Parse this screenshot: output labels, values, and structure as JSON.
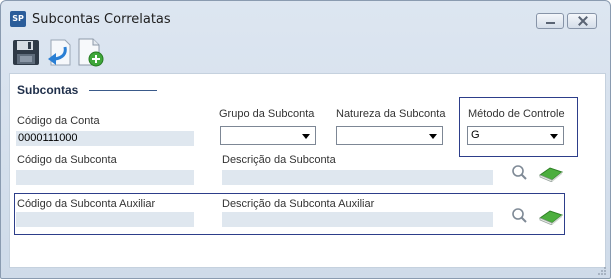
{
  "window": {
    "app_icon_text": "SP",
    "title": "Subcontas Correlatas"
  },
  "toolbar": {
    "buttons": [
      {
        "name": "save",
        "icon": "floppy-disk-icon"
      },
      {
        "name": "return",
        "icon": "return-arrow-icon"
      },
      {
        "name": "new",
        "icon": "new-document-icon"
      }
    ]
  },
  "section": {
    "title": "Subcontas"
  },
  "fields": {
    "codigo_conta": {
      "label": "Código da Conta",
      "value": "0000111000"
    },
    "grupo_subconta": {
      "label": "Grupo da Subconta",
      "value": ""
    },
    "natureza_subconta": {
      "label": "Natureza da Subconta",
      "value": ""
    },
    "metodo_controle": {
      "label": "Método de Controle",
      "value": "G"
    },
    "codigo_subconta": {
      "label": "Código da Subconta",
      "value": ""
    },
    "descricao_subconta": {
      "label": "Descrição da Subconta",
      "value": ""
    },
    "codigo_subconta_aux": {
      "label": "Código da Subconta Auxiliar",
      "value": ""
    },
    "descricao_subconta_aux": {
      "label": "Descrição da Subconta Auxiliar",
      "value": ""
    }
  },
  "colors": {
    "field_bg": "#dfe7ef",
    "group_border": "#2d3e8a",
    "window_bg": "#d6e0ec"
  }
}
